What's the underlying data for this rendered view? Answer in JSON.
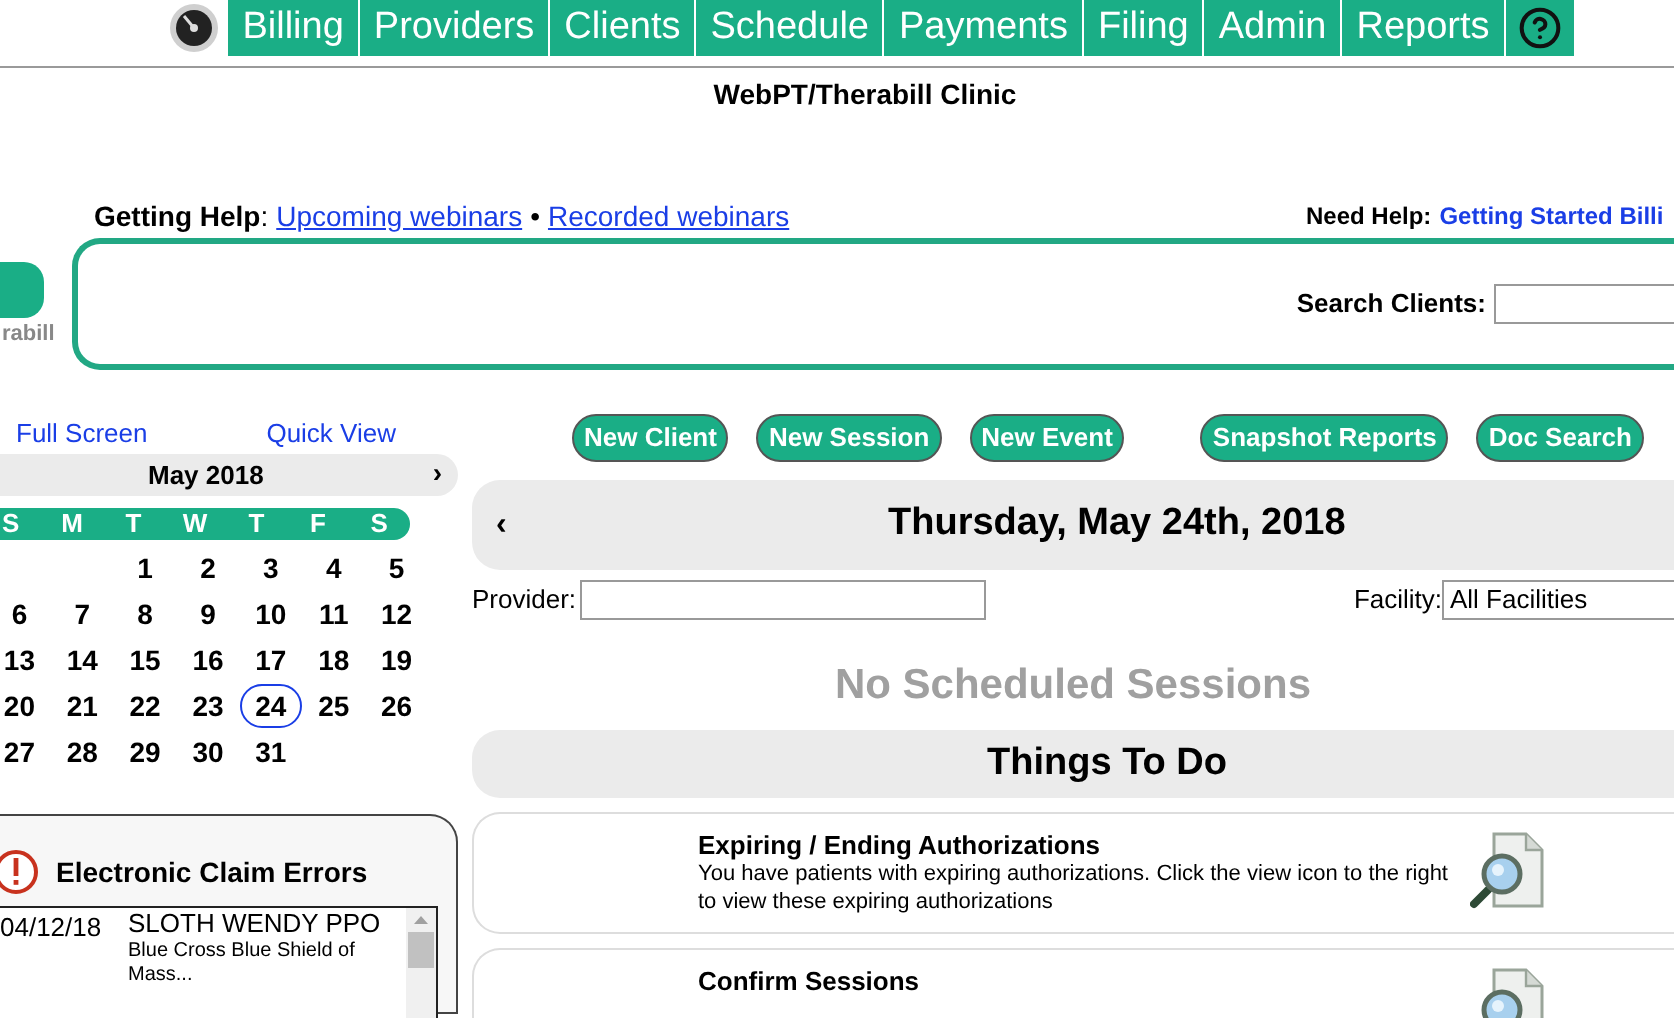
{
  "nav": {
    "tabs": [
      {
        "label": "Billing"
      },
      {
        "label": "Providers"
      },
      {
        "label": "Clients"
      },
      {
        "label": "Schedule"
      },
      {
        "label": "Payments"
      },
      {
        "label": "Filing"
      },
      {
        "label": "Admin"
      },
      {
        "label": "Reports"
      }
    ]
  },
  "clinic_title": "WebPT/Therabill Clinic",
  "help": {
    "label": "**Getting Help**:",
    "links": [
      "Upcoming webinars",
      "Recorded webinars"
    ],
    "separator": "•",
    "need_help_label": "Need Help:",
    "need_help_link": "Getting Started Billi"
  },
  "logo_text": "rabill",
  "search": {
    "label": "Search Clients:"
  },
  "view_links": [
    "Full Screen",
    "Quick View"
  ],
  "calendar": {
    "month": "May 2018",
    "next": "›",
    "weekdays": [
      "S",
      "M",
      "T",
      "W",
      "T",
      "F",
      "S"
    ],
    "weeks": [
      [
        {
          "day": "1",
          "selected": false
        },
        {
          "day": "2",
          "selected": false
        },
        {
          "day": "3",
          "selected": false
        },
        {
          "day": "4",
          "selected": false
        },
        {
          "day": "5",
          "selected": false
        }
      ],
      [
        {
          "day": "6",
          "selected": false
        },
        {
          "day": "7",
          "selected": false
        },
        {
          "day": "8",
          "selected": false
        },
        {
          "day": "9",
          "selected": false
        },
        {
          "day": "10",
          "selected": false
        },
        {
          "day": "11",
          "selected": false
        },
        {
          "day": "12",
          "selected": false
        }
      ],
      [
        {
          "day": "13",
          "selected": false
        },
        {
          "day": "14",
          "selected": false
        },
        {
          "day": "15",
          "selected": false
        },
        {
          "day": "16",
          "selected": false
        },
        {
          "day": "17",
          "selected": false
        },
        {
          "day": "18",
          "selected": false
        },
        {
          "day": "19",
          "selected": false
        }
      ],
      [
        {
          "day": "20",
          "selected": false
        },
        {
          "day": "21",
          "selected": false
        },
        {
          "day": "22",
          "selected": false
        },
        {
          "day": "23",
          "selected": false
        },
        {
          "day": "24",
          "selected": true
        },
        {
          "day": "25",
          "selected": false
        },
        {
          "day": "26",
          "selected": false
        }
      ],
      [
        {
          "day": "27",
          "selected": false
        },
        {
          "day": "28",
          "selected": false
        },
        {
          "day": "29",
          "selected": false
        },
        {
          "day": "30",
          "selected": false
        },
        {
          "day": "31",
          "selected": false
        }
      ]
    ]
  },
  "claim_errors": {
    "title": "Electronic Claim Errors",
    "rows": [
      {
        "date": "04/12/18",
        "name": "SLOTH WENDY PPO",
        "payer": "Blue Cross Blue Shield of Mass..."
      }
    ]
  },
  "actions": [
    "New Client",
    "New Session",
    "New Event",
    "Snapshot Reports",
    "Doc Search"
  ],
  "schedule": {
    "prev": "‹",
    "date": "Thursday, May 24th, 2018",
    "provider_label": "Provider:",
    "facility_label": "Facility:",
    "facility_value": "All Facilities",
    "empty_message": "No Scheduled Sessions"
  },
  "todo": {
    "title": "Things To Do",
    "items": [
      {
        "title": "Expiring / Ending Authorizations",
        "description": "You have patients with expiring authorizations. Click the view icon to the right to view these expiring authorizations"
      },
      {
        "title": "Confirm Sessions"
      }
    ]
  }
}
